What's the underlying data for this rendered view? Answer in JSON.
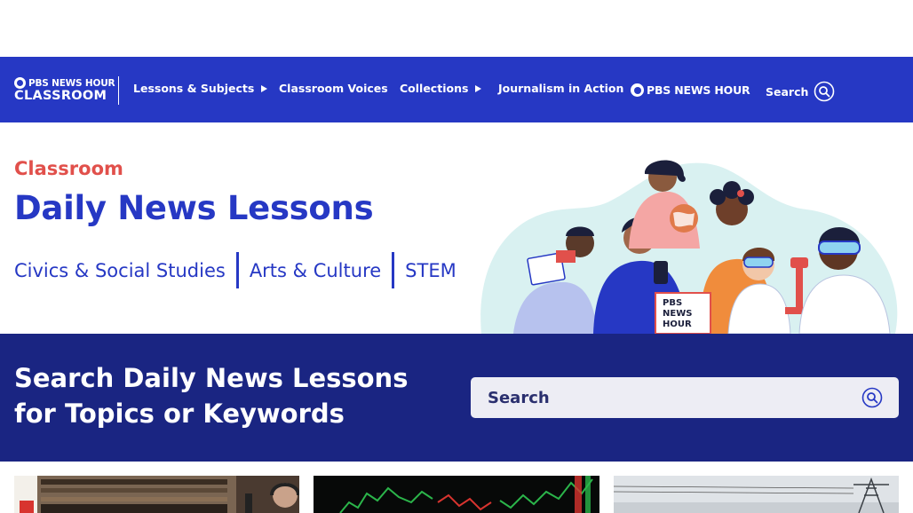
{
  "nav": {
    "logo_top": "PBS NEWS HOUR",
    "logo_bottom": "CLASSROOM",
    "items": [
      {
        "label": "Lessons & Subjects",
        "has_menu": true
      },
      {
        "label": "Classroom Voices",
        "has_menu": false
      },
      {
        "label": "Collections",
        "has_menu": true
      },
      {
        "label": "Journalism in Action",
        "has_menu": false
      }
    ],
    "partner_logo": "PBS NEWS HOUR",
    "search_label": "Search"
  },
  "hero": {
    "eyebrow": "Classroom",
    "title": "Daily News Lessons",
    "subjects": [
      "Civics & Social Studies",
      "Arts & Culture",
      "STEM"
    ],
    "illustration_badge": [
      "PBS",
      "NEWS",
      "HOUR"
    ]
  },
  "search_band": {
    "title": "Search Daily News Lessons for Topics or Keywords",
    "placeholder": "Search"
  },
  "colors": {
    "nav_bg": "#2638c4",
    "band_bg": "#1a2582",
    "accent_red": "#e1504b",
    "brand_blue": "#2638c4"
  }
}
